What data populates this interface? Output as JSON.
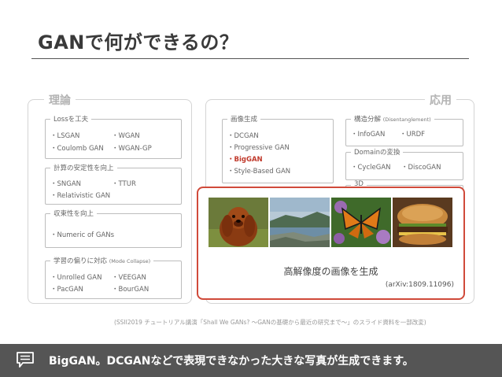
{
  "slide": {
    "title": "GANで何ができるの？",
    "footnote": "(SSII2019 チュートリアル講演「Shall We GANs? 〜GANの基礎から最近の研究まで〜」のスライド資料を一部改変)",
    "caption": "BigGAN。DCGANなどで表現できなかった大きな写真が生成できます。",
    "caption_icon": "comment-icon"
  },
  "theory": {
    "label": "理論",
    "groups": [
      {
        "label": "Lossを工夫",
        "items": [
          "・LSGAN",
          "・WGAN",
          "・Coulomb GAN",
          "・WGAN-GP"
        ]
      },
      {
        "label": "計算の安定性を向上",
        "items": [
          "・SNGAN",
          "・TTUR",
          "・Relativistic GAN"
        ]
      },
      {
        "label": "収束性を向上",
        "items": [
          "・Numeric of GANs"
        ]
      },
      {
        "label": "学習の偏りに対応",
        "sublabel": "(Mode Collapse)",
        "items": [
          "・Unrolled GAN",
          "・VEEGAN",
          "・PacGAN",
          "・BourGAN"
        ]
      }
    ]
  },
  "application": {
    "label": "応用",
    "image_gen": {
      "label": "画像生成",
      "items": [
        "・DCGAN",
        "・Progressive GAN",
        "・BigGAN",
        "・Style-Based GAN"
      ]
    },
    "disentangle": {
      "label": "構造分解",
      "sublabel": "(Disentanglement)",
      "items": [
        "・InfoGAN",
        "・URDF"
      ]
    },
    "domain": {
      "label": "Domainの変換",
      "items": [
        "・CycleGAN",
        "・DiscoGAN"
      ]
    },
    "three_d": {
      "label": "3D"
    }
  },
  "popup": {
    "photos": [
      "dog-photo",
      "coast-photo",
      "butterfly-photo",
      "burger-photo"
    ],
    "text": "高解像度の画像を生成",
    "ref": "(arXiv:1809.11096)"
  },
  "colors": {
    "highlight": "#d04a3a",
    "bar": "#555555"
  }
}
